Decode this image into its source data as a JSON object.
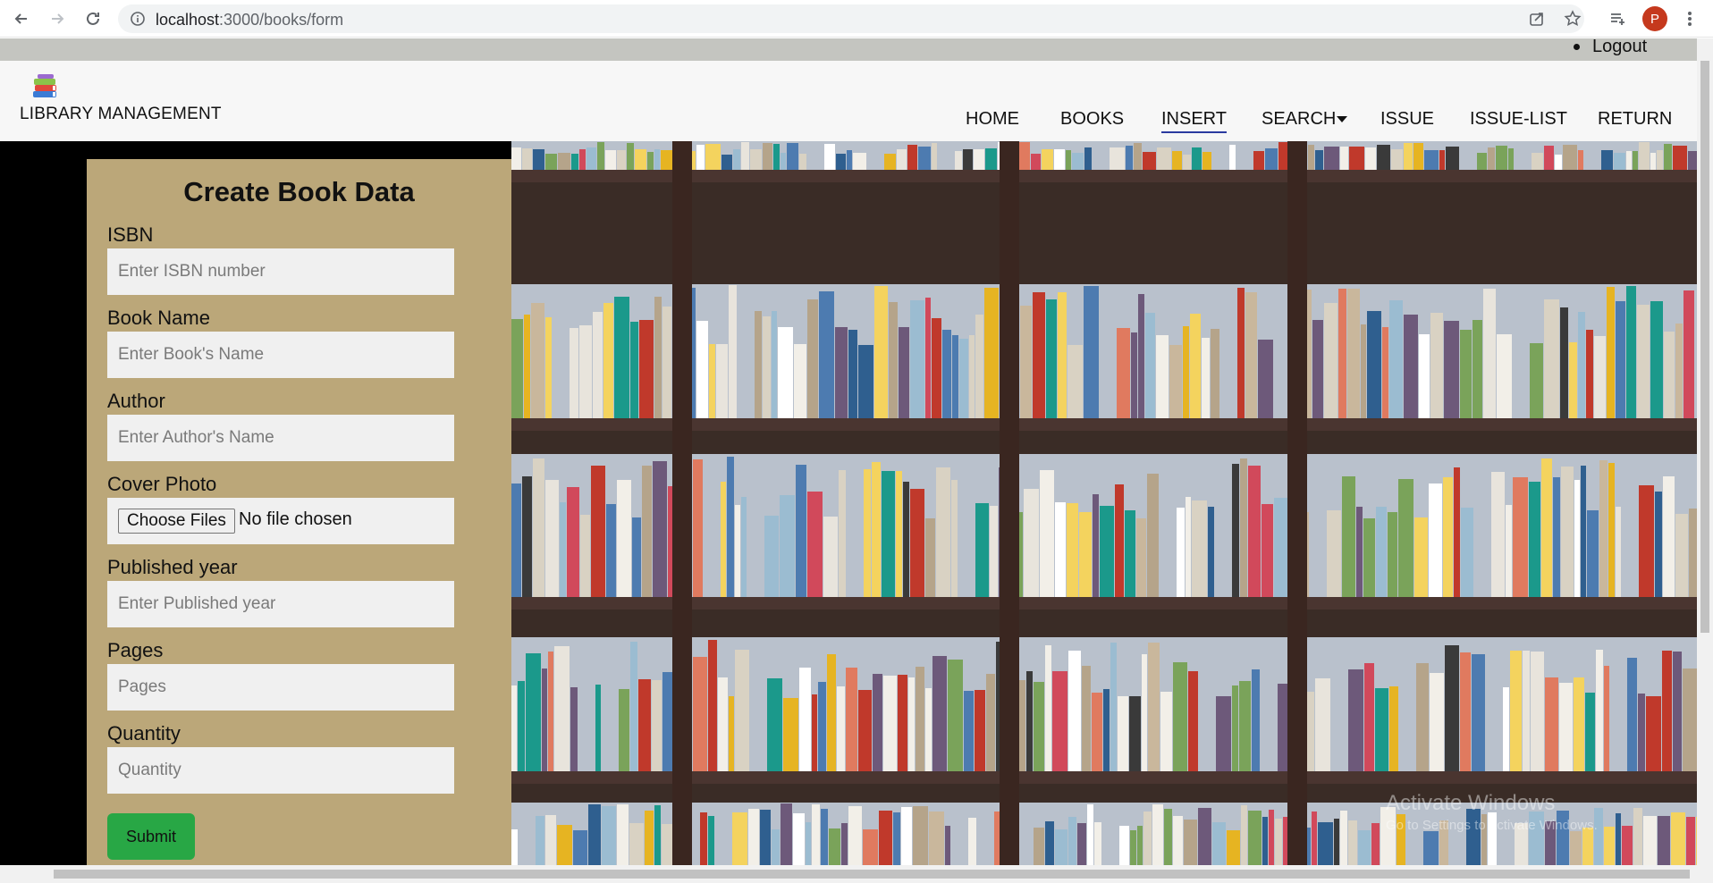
{
  "browser": {
    "url_host": "localhost",
    "url_path": ":3000/books/form",
    "profile_initial": "P"
  },
  "topbar": {
    "logout_label": "Logout"
  },
  "header": {
    "brand": "LIBRARY MANAGEMENT",
    "nav": [
      {
        "label": "HOME"
      },
      {
        "label": "BOOKS"
      },
      {
        "label": "INSERT",
        "active": true
      },
      {
        "label": "SEARCH",
        "dropdown": true
      },
      {
        "label": "ISSUE"
      },
      {
        "label": "ISSUE-LIST"
      },
      {
        "label": "RETURN"
      }
    ]
  },
  "form": {
    "title": "Create Book Data",
    "fields": [
      {
        "label": "ISBN",
        "placeholder": "Enter ISBN number"
      },
      {
        "label": "Book Name",
        "placeholder": "Enter Book's Name"
      },
      {
        "label": "Author",
        "placeholder": "Enter Author's Name"
      },
      {
        "label": "Cover Photo",
        "file_button": "Choose Files",
        "file_status": "No file chosen"
      },
      {
        "label": "Published year",
        "placeholder": "Enter Published year"
      },
      {
        "label": "Pages",
        "placeholder": "Pages"
      },
      {
        "label": "Quantity",
        "placeholder": "Quantity"
      }
    ],
    "submit_label": "Submit"
  },
  "watermark": {
    "line1": "Activate Windows",
    "line2": "Go to Settings to activate Windows."
  },
  "colors": {
    "form_bg": "#bba779",
    "submit_bg": "#28a745",
    "active_underline": "#2a3aa0"
  }
}
